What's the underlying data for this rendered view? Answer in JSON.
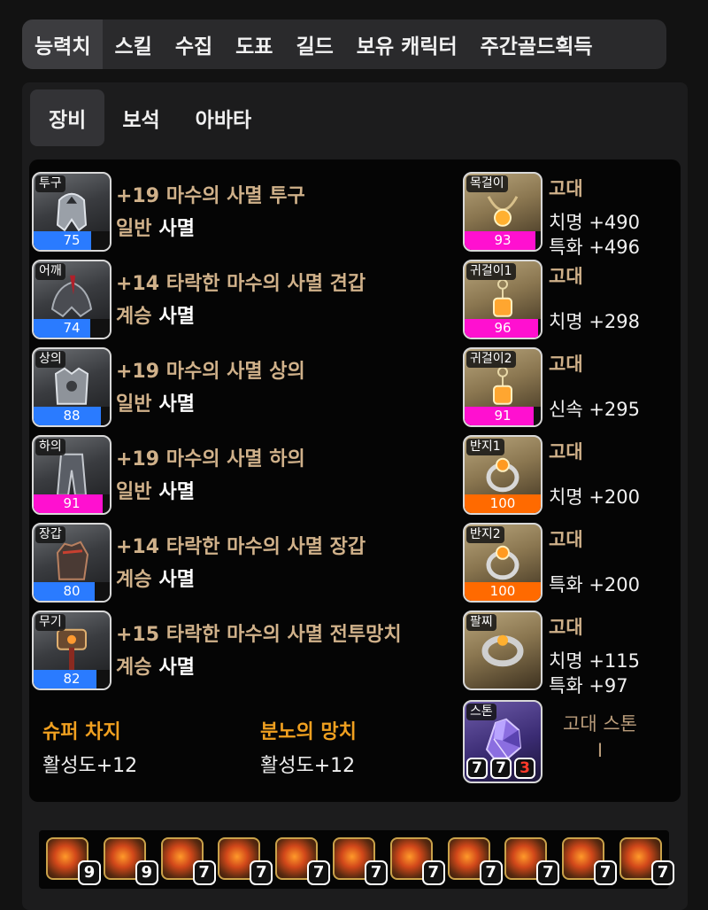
{
  "top_tabs": [
    "능력치",
    "스킬",
    "수집",
    "도표",
    "길드",
    "보유 캐릭터",
    "주간골드획득"
  ],
  "sub_tabs": [
    "장비",
    "보석",
    "아바타"
  ],
  "colors": {
    "accent_text": "#d0b18a",
    "quality_blue": "#2a7bff",
    "quality_magenta": "#ff10d0",
    "quality_orange": "#ff6a00",
    "engraving": "#f0a020",
    "stone_red": "#ff3a2a"
  },
  "equipment": [
    {
      "slot": "투구",
      "name": "+19 마수의 사멸 투구",
      "grade": "일반",
      "set": "사멸",
      "quality": "75",
      "quality_color": "#2a7bff",
      "icon": "helmet-icon"
    },
    {
      "slot": "어깨",
      "name": "+14 타락한 마수의 사멸 견갑",
      "grade": "계승",
      "set": "사멸",
      "quality": "74",
      "quality_color": "#2a7bff",
      "icon": "shoulder-icon"
    },
    {
      "slot": "상의",
      "name": "+19 마수의 사멸 상의",
      "grade": "일반",
      "set": "사멸",
      "quality": "88",
      "quality_color": "#2a7bff",
      "icon": "chest-icon"
    },
    {
      "slot": "하의",
      "name": "+19 마수의 사멸 하의",
      "grade": "일반",
      "set": "사멸",
      "quality": "91",
      "quality_color": "#ff10d0",
      "icon": "pants-icon"
    },
    {
      "slot": "장갑",
      "name": "+14 타락한 마수의 사멸 장갑",
      "grade": "계승",
      "set": "사멸",
      "quality": "80",
      "quality_color": "#2a7bff",
      "icon": "gloves-icon"
    },
    {
      "slot": "무기",
      "name": "+15 타락한 마수의 사멸 전투망치",
      "grade": "계승",
      "set": "사멸",
      "quality": "82",
      "quality_color": "#2a7bff",
      "icon": "weapon-icon"
    }
  ],
  "accessories": [
    {
      "slot": "목걸이",
      "grade": "고대",
      "stats": [
        "치명 +490",
        "특화 +496"
      ],
      "quality": "93",
      "quality_color": "#ff10d0",
      "icon": "necklace-icon"
    },
    {
      "slot": "귀걸이1",
      "grade": "고대",
      "stats": [
        "치명 +298"
      ],
      "quality": "96",
      "quality_color": "#ff10d0",
      "icon": "earring-icon"
    },
    {
      "slot": "귀걸이2",
      "grade": "고대",
      "stats": [
        "신속 +295"
      ],
      "quality": "91",
      "quality_color": "#ff10d0",
      "icon": "earring-icon"
    },
    {
      "slot": "반지1",
      "grade": "고대",
      "stats": [
        "치명 +200"
      ],
      "quality": "100",
      "quality_color": "#ff6a00",
      "icon": "ring-icon"
    },
    {
      "slot": "반지2",
      "grade": "고대",
      "stats": [
        "특화 +200"
      ],
      "quality": "100",
      "quality_color": "#ff6a00",
      "icon": "ring-icon"
    },
    {
      "slot": "팔찌",
      "grade": "고대",
      "stats": [
        "치명 +115",
        "특화 +97"
      ],
      "quality": "",
      "quality_color": "",
      "icon": "bracelet-icon"
    }
  ],
  "stone": {
    "slot": "스톤",
    "title_line1": "고대 스톤",
    "title_line2": "I",
    "levels": [
      "7",
      "7",
      "3"
    ],
    "icon": "ability-stone-icon"
  },
  "engravings": [
    {
      "name": "슈퍼 차지",
      "value": "활성도+12"
    },
    {
      "name": "분노의 망치",
      "value": "활성도+12"
    }
  ],
  "gems": [
    "9",
    "9",
    "7",
    "7",
    "7",
    "7",
    "7",
    "7",
    "7",
    "7",
    "7"
  ]
}
